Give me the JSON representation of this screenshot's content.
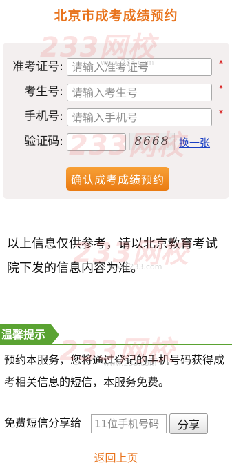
{
  "header": {
    "title": "北京市成考成绩预约"
  },
  "form": {
    "ticket_number": {
      "label": "准考证号:",
      "placeholder": "请输入准考证号"
    },
    "student_number": {
      "label": "考生号:",
      "placeholder": "请输入考生号"
    },
    "phone": {
      "label": "手机号:",
      "placeholder": "请输入手机号"
    },
    "captcha": {
      "label": "验证码:",
      "image_text": "8668",
      "refresh_label": "换一张"
    },
    "required_mark": "*",
    "submit_label": "确认成考成绩预约"
  },
  "notice": {
    "text": "以上信息仅供参考，请以北京教育考试院下发的信息内容为准。"
  },
  "tips": {
    "title": "温馨提示",
    "body": "预约本服务，您将通过登记的手机号码获得成考相关信息的短信，本服务免费。",
    "share_label": "免费短信分享给",
    "share_placeholder": "11位手机号码",
    "share_button_label": "分享"
  },
  "footer": {
    "back_label": "返回上页"
  },
  "watermark": {
    "logo_text": "233网校",
    "site_text": "www.233.com"
  },
  "colors": {
    "accent_orange": "#e8731c",
    "button_orange": "#ea7b12",
    "tips_green": "#5aa332",
    "required_red": "#d40000",
    "link_blue": "#1a3fc4",
    "panel_background": "#f3efef"
  }
}
